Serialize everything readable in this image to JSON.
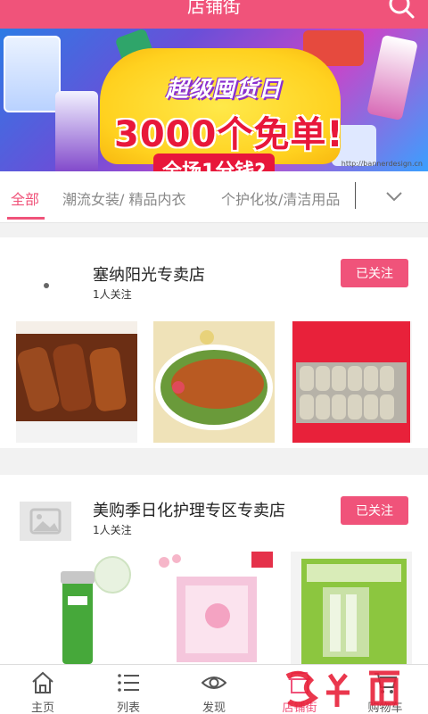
{
  "header": {
    "title": "店铺街"
  },
  "banner": {
    "headline": "超级囤货日",
    "main": "3000个免单!",
    "sub": "全场1分钱?",
    "url": "http://bannerdesign.cn"
  },
  "tabs": [
    {
      "label": "全部",
      "active": true
    },
    {
      "label": "潮流女装/ 精品内衣",
      "active": false
    },
    {
      "label": "个护化妆/清洁用品",
      "active": false
    }
  ],
  "stores": [
    {
      "name": "塞纳阳光专卖店",
      "followers": "1人关注",
      "follow_label": "已关注"
    },
    {
      "name": "美购季日化护理专区专卖店",
      "followers": "1人关注",
      "follow_label": "已关注"
    }
  ],
  "nav": [
    {
      "label": "主页",
      "icon": "home-icon",
      "active": false
    },
    {
      "label": "列表",
      "icon": "list-icon",
      "active": false
    },
    {
      "label": "发现",
      "icon": "eye-icon",
      "active": false
    },
    {
      "label": "店铺街",
      "icon": "store-icon",
      "active": true
    },
    {
      "label": "购物车",
      "icon": "cart-icon",
      "active": false
    }
  ],
  "colors": {
    "accent": "#f0537a",
    "text": "#222222",
    "muted": "#888888"
  }
}
